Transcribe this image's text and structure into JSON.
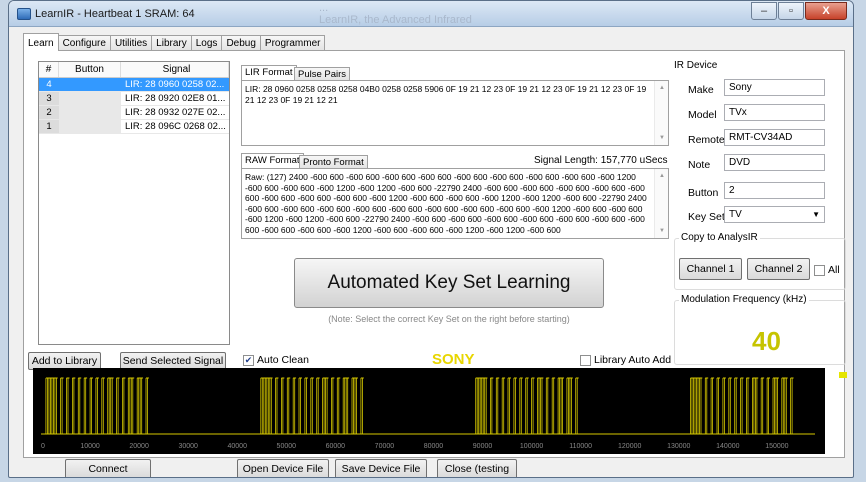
{
  "window": {
    "title": "LearnIR - Heartbeat 1 SRAM: 64",
    "ghost_line1": "...",
    "ghost_line2": "LearnIR, the Advanced Infrared",
    "controls": {
      "minimize": "–",
      "maximize": "▫",
      "close": "X"
    }
  },
  "tabs": [
    "Learn",
    "Configure",
    "Utilities",
    "Library",
    "Logs",
    "Debug",
    "Programmer"
  ],
  "signal_list": {
    "headers": [
      "#",
      "Button",
      "Signal"
    ],
    "rows": [
      {
        "num": "4",
        "button": "",
        "signal": "LIR: 28 0960 0258 02..."
      },
      {
        "num": "3",
        "button": "",
        "signal": "LIR: 28 0920 02E8 01..."
      },
      {
        "num": "2",
        "button": "",
        "signal": "LIR: 28 0932 027E 02..."
      },
      {
        "num": "1",
        "button": "",
        "signal": "LIR: 28 096C 0268 02..."
      }
    ]
  },
  "lir_tabs": [
    "LIR Format",
    "Pulse Pairs"
  ],
  "lir_text": "LIR: 28 0960 0258 0258 0258 04B0 0258 0258 5906 0F 19 21 12 23 0F 19 21 12 23 0F 19 21 12 23 0F 19 21 12 23 0F 19 21 12 21",
  "raw_tabs": [
    "RAW Format",
    "Pronto Format"
  ],
  "signal_length": "Signal Length: 157,770 uSecs",
  "raw_text": "Raw: (127) 2400 -600 600 -600 600 -600 600 -600 600 -600 600 -600 600 -600 600 -600 600 -600 1200 -600 600 -600 600 -600 1200 -600 1200 -600 600 -22790 2400 -600 600 -600 600 -600 600 -600 600 -600 600 -600 600 -600 600 -600 600 -600 1200 -600 600 -600 600 -600 1200 -600 1200 -600 600 -22790 2400 -600 600 -600 600 -600 600 -600 600 -600 600 -600 600 -600 600 -600 600 -600 1200 -600 600 -600 600 -600 1200 -600 1200 -600 600 -22790 2400 -600 600 -600 600 -600 600 -600 600 -600 600 -600 600 -600 600 -600 600 -600 600 -600 1200 -600 600 -600 600 -600 1200 -600 1200 -600 600",
  "automated_button": "Automated Key Set Learning",
  "automated_note": "(Note: Select the correct Key Set on the right before starting)",
  "ir_device": {
    "title": "IR Device",
    "make_label": "Make",
    "make": "Sony",
    "model_label": "Model",
    "model": "TVx",
    "remote_label": "Remote",
    "remote": "RMT-CV34AD",
    "note_label": "Note",
    "note": "DVD",
    "button_label": "Button",
    "button": "2",
    "keyset_label": "Key Set",
    "keyset": "TV"
  },
  "copy_group": {
    "title": "Copy to AnalysIR",
    "channel1": "Channel 1",
    "channel2": "Channel 2",
    "all": "All"
  },
  "modulation": {
    "title": "Modulation Frequency (kHz)",
    "value": "40"
  },
  "left_buttons": {
    "add_library": "Add to Library",
    "send_selected": "Send Selected Signal"
  },
  "auto_clean": "Auto Clean",
  "protocol": "SONY",
  "library_auto_add": "Library Auto Add",
  "bottom_buttons": {
    "connect": "Connect",
    "open_device": "Open Device File",
    "save_device": "Save Device File",
    "close": "Close (testing"
  },
  "colors": {
    "signal": "#d6c800",
    "plot_bg": "#000000",
    "selected_row": "#3399ff"
  },
  "chart_data": {
    "type": "line",
    "x_ticks": [
      0,
      10000,
      20000,
      30000,
      40000,
      50000,
      60000,
      70000,
      80000,
      90000,
      100000,
      110000,
      120000,
      130000,
      140000,
      150000
    ],
    "xlim": [
      0,
      157770
    ],
    "bursts": [
      [
        1000,
        3400
      ],
      [
        4000,
        4600
      ],
      [
        5200,
        5800
      ],
      [
        6400,
        7000
      ],
      [
        7600,
        8200
      ],
      [
        8800,
        9400
      ],
      [
        10000,
        10600
      ],
      [
        11200,
        11800
      ],
      [
        12400,
        13000
      ],
      [
        13600,
        14800
      ],
      [
        15400,
        16000
      ],
      [
        16600,
        17200
      ],
      [
        17800,
        19000
      ],
      [
        19600,
        20800
      ],
      [
        21400,
        22000
      ],
      [
        44800,
        47200
      ],
      [
        47800,
        48400
      ],
      [
        49000,
        49600
      ],
      [
        50200,
        50800
      ],
      [
        51400,
        52000
      ],
      [
        52600,
        53200
      ],
      [
        53800,
        54400
      ],
      [
        55000,
        55600
      ],
      [
        56200,
        56800
      ],
      [
        57400,
        58600
      ],
      [
        59200,
        59800
      ],
      [
        60400,
        61000
      ],
      [
        61600,
        62800
      ],
      [
        63400,
        64600
      ],
      [
        65200,
        65800
      ],
      [
        88600,
        91000
      ],
      [
        91600,
        92200
      ],
      [
        92800,
        93400
      ],
      [
        94000,
        94600
      ],
      [
        95200,
        95800
      ],
      [
        96400,
        97000
      ],
      [
        97600,
        98200
      ],
      [
        98800,
        99400
      ],
      [
        100000,
        100600
      ],
      [
        101200,
        102400
      ],
      [
        103000,
        103600
      ],
      [
        104200,
        104800
      ],
      [
        105400,
        106600
      ],
      [
        107200,
        108400
      ],
      [
        109000,
        109600
      ],
      [
        132400,
        134800
      ],
      [
        135400,
        136000
      ],
      [
        136600,
        137200
      ],
      [
        137800,
        138400
      ],
      [
        139000,
        139600
      ],
      [
        140200,
        140800
      ],
      [
        141400,
        142000
      ],
      [
        142600,
        143200
      ],
      [
        143800,
        144400
      ],
      [
        145000,
        146200
      ],
      [
        146800,
        147400
      ],
      [
        148000,
        148600
      ],
      [
        149200,
        150400
      ],
      [
        151000,
        152200
      ],
      [
        152800,
        153400
      ]
    ]
  }
}
